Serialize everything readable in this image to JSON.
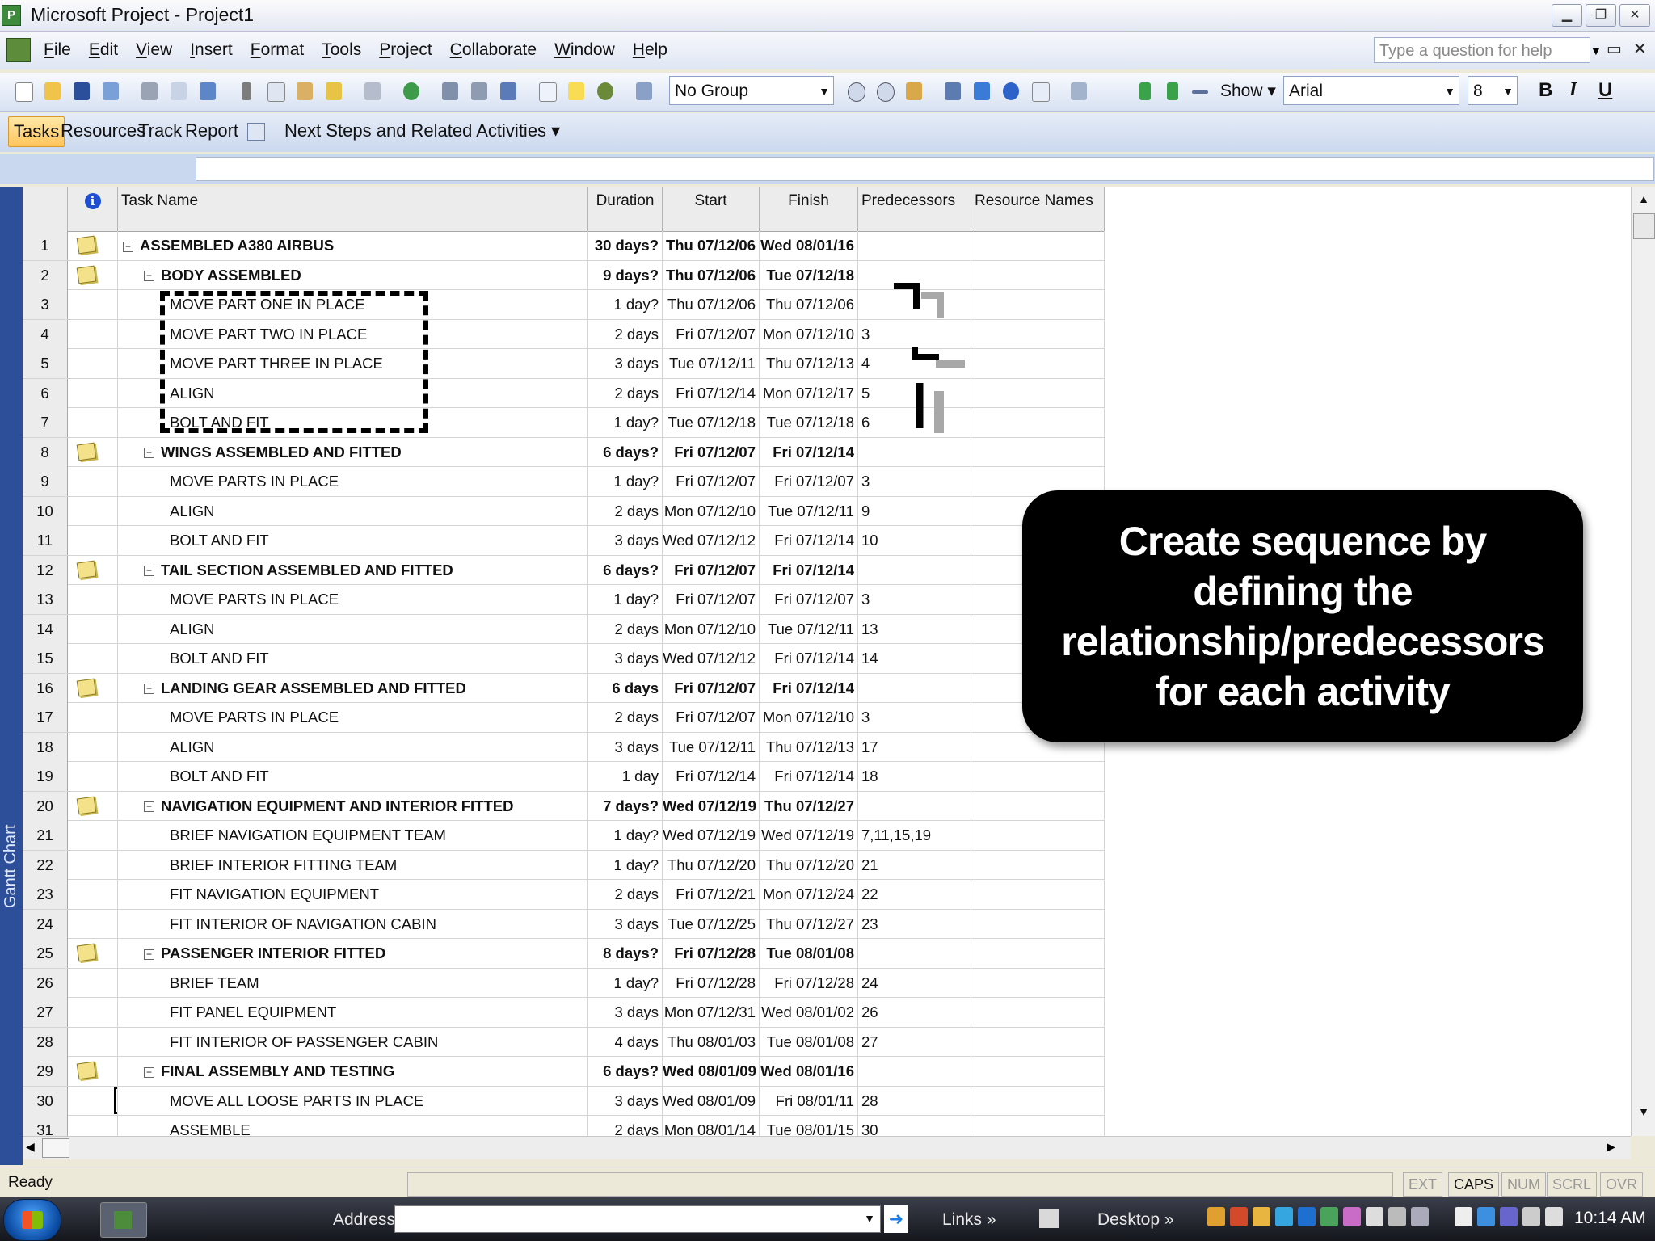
{
  "window": {
    "title": "Microsoft Project - Project1",
    "min": "▁",
    "max": "❐",
    "close": "✕"
  },
  "menubar": {
    "items": [
      "File",
      "Edit",
      "View",
      "Insert",
      "Format",
      "Tools",
      "Project",
      "Collaborate",
      "Window",
      "Help"
    ],
    "help_placeholder": "Type a question for help",
    "mdi_controls": "▭✕"
  },
  "toolbar": {
    "group_select": "No Group",
    "show_label": "Show",
    "font": "Arial",
    "font_size": "8",
    "bold": "B",
    "italic": "I",
    "underline": "U"
  },
  "guide": {
    "tasks": "Tasks",
    "resources": "Resources",
    "track": "Track",
    "report": "Report",
    "next_steps": "Next Steps and Related Activities"
  },
  "sidebar_label": "Gantt Chart",
  "table": {
    "headers": {
      "task_name": "Task Name",
      "duration": "Duration",
      "start": "Start",
      "finish": "Finish",
      "predecessors": "Predecessors",
      "resource_names": "Resource Names",
      "info_icon": "i"
    },
    "rows": [
      {
        "id": "1",
        "name": "ASSEMBLED A380 AIRBUS",
        "duration": "30 days?",
        "start": "Thu 07/12/06",
        "finish": "Wed 08/01/16",
        "pred": "",
        "summary": true,
        "level": 0,
        "note": true
      },
      {
        "id": "2",
        "name": "BODY ASSEMBLED",
        "duration": "9 days?",
        "start": "Thu 07/12/06",
        "finish": "Tue 07/12/18",
        "pred": "",
        "summary": true,
        "level": 1,
        "note": true
      },
      {
        "id": "3",
        "name": "MOVE PART ONE IN PLACE",
        "duration": "1 day?",
        "start": "Thu 07/12/06",
        "finish": "Thu 07/12/06",
        "pred": "",
        "summary": false,
        "level": 2,
        "note": false
      },
      {
        "id": "4",
        "name": "MOVE PART TWO IN PLACE",
        "duration": "2 days",
        "start": "Fri 07/12/07",
        "finish": "Mon 07/12/10",
        "pred": "3",
        "summary": false,
        "level": 2,
        "note": false
      },
      {
        "id": "5",
        "name": "MOVE PART THREE IN PLACE",
        "duration": "3 days",
        "start": "Tue 07/12/11",
        "finish": "Thu 07/12/13",
        "pred": "4",
        "summary": false,
        "level": 2,
        "note": false
      },
      {
        "id": "6",
        "name": "ALIGN",
        "duration": "2 days",
        "start": "Fri 07/12/14",
        "finish": "Mon 07/12/17",
        "pred": "5",
        "summary": false,
        "level": 2,
        "note": false
      },
      {
        "id": "7",
        "name": "BOLT AND FIT",
        "duration": "1 day?",
        "start": "Tue 07/12/18",
        "finish": "Tue 07/12/18",
        "pred": "6",
        "summary": false,
        "level": 2,
        "note": false
      },
      {
        "id": "8",
        "name": "WINGS ASSEMBLED AND FITTED",
        "duration": "6 days?",
        "start": "Fri 07/12/07",
        "finish": "Fri 07/12/14",
        "pred": "",
        "summary": true,
        "level": 1,
        "note": true
      },
      {
        "id": "9",
        "name": "MOVE PARTS IN PLACE",
        "duration": "1 day?",
        "start": "Fri 07/12/07",
        "finish": "Fri 07/12/07",
        "pred": "3",
        "summary": false,
        "level": 2,
        "note": false
      },
      {
        "id": "10",
        "name": "ALIGN",
        "duration": "2 days",
        "start": "Mon 07/12/10",
        "finish": "Tue 07/12/11",
        "pred": "9",
        "summary": false,
        "level": 2,
        "note": false
      },
      {
        "id": "11",
        "name": "BOLT AND FIT",
        "duration": "3 days",
        "start": "Wed 07/12/12",
        "finish": "Fri 07/12/14",
        "pred": "10",
        "summary": false,
        "level": 2,
        "note": false
      },
      {
        "id": "12",
        "name": "TAIL SECTION ASSEMBLED AND FITTED",
        "duration": "6 days?",
        "start": "Fri 07/12/07",
        "finish": "Fri 07/12/14",
        "pred": "",
        "summary": true,
        "level": 1,
        "note": true
      },
      {
        "id": "13",
        "name": "MOVE PARTS IN PLACE",
        "duration": "1 day?",
        "start": "Fri 07/12/07",
        "finish": "Fri 07/12/07",
        "pred": "3",
        "summary": false,
        "level": 2,
        "note": false
      },
      {
        "id": "14",
        "name": "ALIGN",
        "duration": "2 days",
        "start": "Mon 07/12/10",
        "finish": "Tue 07/12/11",
        "pred": "13",
        "summary": false,
        "level": 2,
        "note": false
      },
      {
        "id": "15",
        "name": "BOLT AND FIT",
        "duration": "3 days",
        "start": "Wed 07/12/12",
        "finish": "Fri 07/12/14",
        "pred": "14",
        "summary": false,
        "level": 2,
        "note": false
      },
      {
        "id": "16",
        "name": "LANDING GEAR ASSEMBLED AND FITTED",
        "duration": "6 days",
        "start": "Fri 07/12/07",
        "finish": "Fri 07/12/14",
        "pred": "",
        "summary": true,
        "level": 1,
        "note": true
      },
      {
        "id": "17",
        "name": "MOVE PARTS IN PLACE",
        "duration": "2 days",
        "start": "Fri 07/12/07",
        "finish": "Mon 07/12/10",
        "pred": "3",
        "summary": false,
        "level": 2,
        "note": false
      },
      {
        "id": "18",
        "name": "ALIGN",
        "duration": "3 days",
        "start": "Tue 07/12/11",
        "finish": "Thu 07/12/13",
        "pred": "17",
        "summary": false,
        "level": 2,
        "note": false
      },
      {
        "id": "19",
        "name": "BOLT AND FIT",
        "duration": "1 day",
        "start": "Fri 07/12/14",
        "finish": "Fri 07/12/14",
        "pred": "18",
        "summary": false,
        "level": 2,
        "note": false
      },
      {
        "id": "20",
        "name": "NAVIGATION EQUIPMENT AND INTERIOR FITTED",
        "duration": "7 days?",
        "start": "Wed 07/12/19",
        "finish": "Thu 07/12/27",
        "pred": "",
        "summary": true,
        "level": 1,
        "note": true
      },
      {
        "id": "21",
        "name": "BRIEF NAVIGATION EQUIPMENT TEAM",
        "duration": "1 day?",
        "start": "Wed 07/12/19",
        "finish": "Wed 07/12/19",
        "pred": "7,11,15,19",
        "summary": false,
        "level": 2,
        "note": false
      },
      {
        "id": "22",
        "name": "BRIEF INTERIOR FITTING TEAM",
        "duration": "1 day?",
        "start": "Thu 07/12/20",
        "finish": "Thu 07/12/20",
        "pred": "21",
        "summary": false,
        "level": 2,
        "note": false
      },
      {
        "id": "23",
        "name": "FIT NAVIGATION EQUIPMENT",
        "duration": "2 days",
        "start": "Fri 07/12/21",
        "finish": "Mon 07/12/24",
        "pred": "22",
        "summary": false,
        "level": 2,
        "note": false
      },
      {
        "id": "24",
        "name": "FIT INTERIOR OF NAVIGATION CABIN",
        "duration": "3 days",
        "start": "Tue 07/12/25",
        "finish": "Thu 07/12/27",
        "pred": "23",
        "summary": false,
        "level": 2,
        "note": false
      },
      {
        "id": "25",
        "name": "PASSENGER INTERIOR FITTED",
        "duration": "8 days?",
        "start": "Fri 07/12/28",
        "finish": "Tue 08/01/08",
        "pred": "",
        "summary": true,
        "level": 1,
        "note": true
      },
      {
        "id": "26",
        "name": "BRIEF TEAM",
        "duration": "1 day?",
        "start": "Fri 07/12/28",
        "finish": "Fri 07/12/28",
        "pred": "24",
        "summary": false,
        "level": 2,
        "note": false
      },
      {
        "id": "27",
        "name": "FIT PANEL EQUIPMENT",
        "duration": "3 days",
        "start": "Mon 07/12/31",
        "finish": "Wed 08/01/02",
        "pred": "26",
        "summary": false,
        "level": 2,
        "note": false
      },
      {
        "id": "28",
        "name": "FIT INTERIOR OF PASSENGER CABIN",
        "duration": "4 days",
        "start": "Thu 08/01/03",
        "finish": "Tue 08/01/08",
        "pred": "27",
        "summary": false,
        "level": 2,
        "note": false
      },
      {
        "id": "29",
        "name": "FINAL ASSEMBLY AND TESTING",
        "duration": "6 days?",
        "start": "Wed 08/01/09",
        "finish": "Wed 08/01/16",
        "pred": "",
        "summary": true,
        "level": 1,
        "note": true
      },
      {
        "id": "30",
        "name": "MOVE ALL LOOSE PARTS IN PLACE",
        "duration": "3 days",
        "start": "Wed 08/01/09",
        "finish": "Fri 08/01/11",
        "pred": "28",
        "summary": false,
        "level": 2,
        "note": false
      },
      {
        "id": "31",
        "name": "ASSEMBLE",
        "duration": "2 days",
        "start": "Mon 08/01/14",
        "finish": "Tue 08/01/15",
        "pred": "30",
        "summary": false,
        "level": 2,
        "note": false
      }
    ]
  },
  "callout": "Create sequence by defining the relationship/predecessors for each activity",
  "status": {
    "ready": "Ready",
    "indicators": [
      {
        "label": "EXT",
        "on": false
      },
      {
        "label": "CAPS",
        "on": true
      },
      {
        "label": "NUM",
        "on": false
      },
      {
        "label": "SCRL",
        "on": false
      },
      {
        "label": "OVR",
        "on": false
      }
    ]
  },
  "taskbar": {
    "address_label": "Address",
    "links_label": "Links",
    "desktop_label": "Desktop",
    "chevron": "»",
    "clock": "10:14 AM",
    "go": "➜"
  }
}
